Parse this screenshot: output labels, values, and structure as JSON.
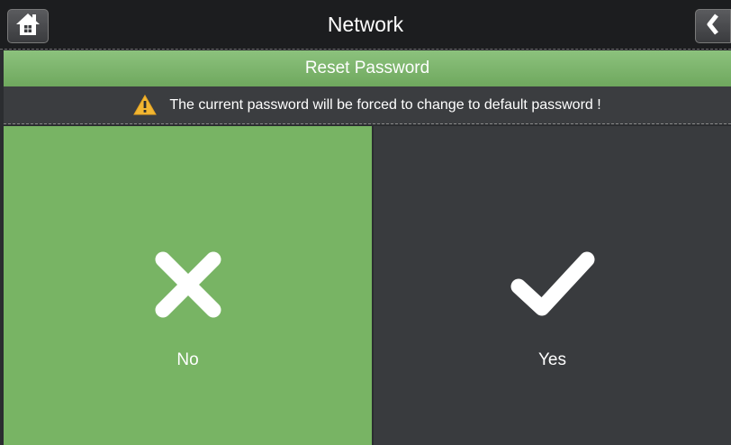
{
  "header": {
    "title": "Network",
    "home_icon": "home-icon",
    "back_icon": "back-chevron-icon"
  },
  "dialog": {
    "title": "Reset Password",
    "warning_icon": "warning-icon",
    "warning_text": "The current password will be forced to change to default password !"
  },
  "buttons": {
    "no": {
      "label": "No",
      "icon": "cross-icon",
      "color": "#78b464"
    },
    "yes": {
      "label": "Yes",
      "icon": "checkmark-icon",
      "color": "#393b3e"
    }
  }
}
